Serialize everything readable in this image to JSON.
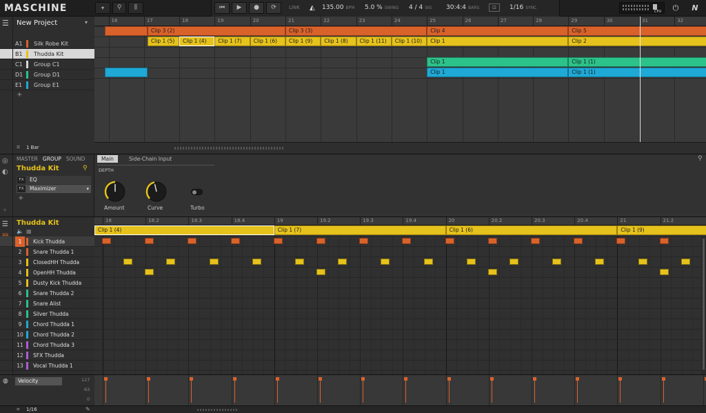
{
  "app": {
    "name": "MASCHINE",
    "project": "New Project"
  },
  "toolbar": {
    "link_label": "LINK",
    "tempo": "135.00",
    "tempo_label": "BPM",
    "swing": "5.0 %",
    "swing_label": "SWING",
    "sig": "4 / 4",
    "sig_label": "SIG",
    "position": "30:4:4",
    "position_label": "BARS",
    "quantize": "1/16",
    "sync_label": "SYNC",
    "cpu_label": "CPU",
    "ni_label": "N"
  },
  "arranger": {
    "bar_numbers": [
      "16",
      "17",
      "18",
      "19",
      "20",
      "21",
      "22",
      "23",
      "24",
      "25",
      "26",
      "27",
      "28",
      "29",
      "30",
      "31",
      "32"
    ],
    "groups": [
      {
        "code": "A1",
        "name": "Silk Robe Kit",
        "color": "#d9622b"
      },
      {
        "code": "B1",
        "name": "Thudda Kit",
        "color": "#e6c21c",
        "selected": true
      },
      {
        "code": "C1",
        "name": "Group C1",
        "color": "#d8d8d8"
      },
      {
        "code": "D1",
        "name": "Group D1",
        "color": "#2bc38a"
      },
      {
        "code": "E1",
        "name": "Group E1",
        "color": "#1fa9d6"
      }
    ],
    "add_label": "+",
    "zoom_label": "1 Bar",
    "clips": {
      "a1": [
        {
          "label": "",
          "start": 15.9,
          "end": 17.1
        },
        {
          "label": "Clip 3 (2)",
          "start": 17.1,
          "end": 21.0
        },
        {
          "label": "Clip 3 (3)",
          "start": 21.0,
          "end": 25.0
        },
        {
          "label": "Clip 4",
          "start": 25.0,
          "end": 29.0
        },
        {
          "label": "Clip 5",
          "start": 29.0,
          "end": 33.2
        }
      ],
      "b1": [
        {
          "label": "Clip 1 (5)",
          "start": 17.1,
          "end": 18.0
        },
        {
          "label": "Clip 1 (4)",
          "start": 18.0,
          "end": 19.0,
          "selected": true
        },
        {
          "label": "Clip 1 (7)",
          "start": 19.0,
          "end": 20.0
        },
        {
          "label": "Clip 1 (6)",
          "start": 20.0,
          "end": 21.0
        },
        {
          "label": "Clip 1 (9)",
          "start": 21.0,
          "end": 22.0
        },
        {
          "label": "Clip 1 (8)",
          "start": 22.0,
          "end": 23.0
        },
        {
          "label": "Clip 1 (11)",
          "start": 23.0,
          "end": 24.0
        },
        {
          "label": "Clip 1 (10)",
          "start": 24.0,
          "end": 25.0
        },
        {
          "label": "Clip 1",
          "start": 25.0,
          "end": 29.0
        },
        {
          "label": "Clip 2",
          "start": 29.0,
          "end": 33.2
        }
      ],
      "d1": [
        {
          "label": "Clip 1",
          "start": 25.0,
          "end": 29.0
        },
        {
          "label": "Clip 1 (1)",
          "start": 29.0,
          "end": 33.2
        }
      ],
      "e1": [
        {
          "label": "",
          "start": 15.9,
          "end": 17.1
        },
        {
          "label": "Clip 1",
          "start": 25.0,
          "end": 29.0
        },
        {
          "label": "Clip 1 (1)",
          "start": 29.0,
          "end": 33.2
        }
      ]
    }
  },
  "plugin_panel": {
    "tabs": [
      "MASTER",
      "GROUP",
      "SOUND"
    ],
    "group_name": "Thudda Kit",
    "slots": [
      {
        "fx": "FX",
        "name": "EQ"
      },
      {
        "fx": "FX",
        "name": "Maximizer"
      }
    ],
    "add_label": "+",
    "page_tabs": [
      "Main",
      "Side-Chain Input"
    ],
    "section": "DEPTH",
    "knobs": [
      {
        "label": "Amount",
        "value": 0.55
      },
      {
        "label": "Curve",
        "value": 0.45
      }
    ],
    "toggle_label": "Turbo"
  },
  "pattern": {
    "group_name": "Thudda Kit",
    "step_labels": [
      "18",
      "18.2",
      "18.3",
      "18.4",
      "19",
      "19.2",
      "19.3",
      "19.4",
      "20",
      "20.2",
      "20.3",
      "20.4",
      "21",
      "21.2"
    ],
    "clips": [
      {
        "label": "Clip 1 (4)",
        "selected": true
      },
      {
        "label": "Clip 1 (7)"
      },
      {
        "label": "Clip 1 (6)"
      },
      {
        "label": "Clip 1 (9)"
      }
    ],
    "sounds": [
      {
        "num": "1",
        "name": "Kick Thudda",
        "color": "#d9622b",
        "selected": true
      },
      {
        "num": "2",
        "name": "Snare Thudda 1",
        "color": "#d9622b"
      },
      {
        "num": "3",
        "name": "ClosedHH Thudda",
        "color": "#e6c21c"
      },
      {
        "num": "4",
        "name": "OpenHH Thudda",
        "color": "#e6c21c"
      },
      {
        "num": "5",
        "name": "Dusty Kick Thudda",
        "color": "#e6c21c"
      },
      {
        "num": "6",
        "name": "Snare Thudda 2",
        "color": "#2bc38a"
      },
      {
        "num": "7",
        "name": "Snare Alist",
        "color": "#2bc38a"
      },
      {
        "num": "8",
        "name": "Silver Thudda",
        "color": "#2bc38a"
      },
      {
        "num": "9",
        "name": "Chord Thudda 1",
        "color": "#1fa9d6"
      },
      {
        "num": "10",
        "name": "Chord Thudda 2",
        "color": "#1fa9d6"
      },
      {
        "num": "11",
        "name": "Chord Thudda 3",
        "color": "#b05ad8"
      },
      {
        "num": "12",
        "name": "SFX Thudda",
        "color": "#b05ad8"
      },
      {
        "num": "13",
        "name": "Vocal Thudda 1",
        "color": "#b05ad8"
      }
    ],
    "velocity_label": "Velocity",
    "velocity_scale": [
      "127",
      "63",
      "0"
    ],
    "footer_quant": "1/16"
  },
  "colors": {
    "orange": "#d9622b",
    "yellow": "#e6c21c",
    "green": "#2bc38a",
    "blue": "#1fa9d6"
  }
}
